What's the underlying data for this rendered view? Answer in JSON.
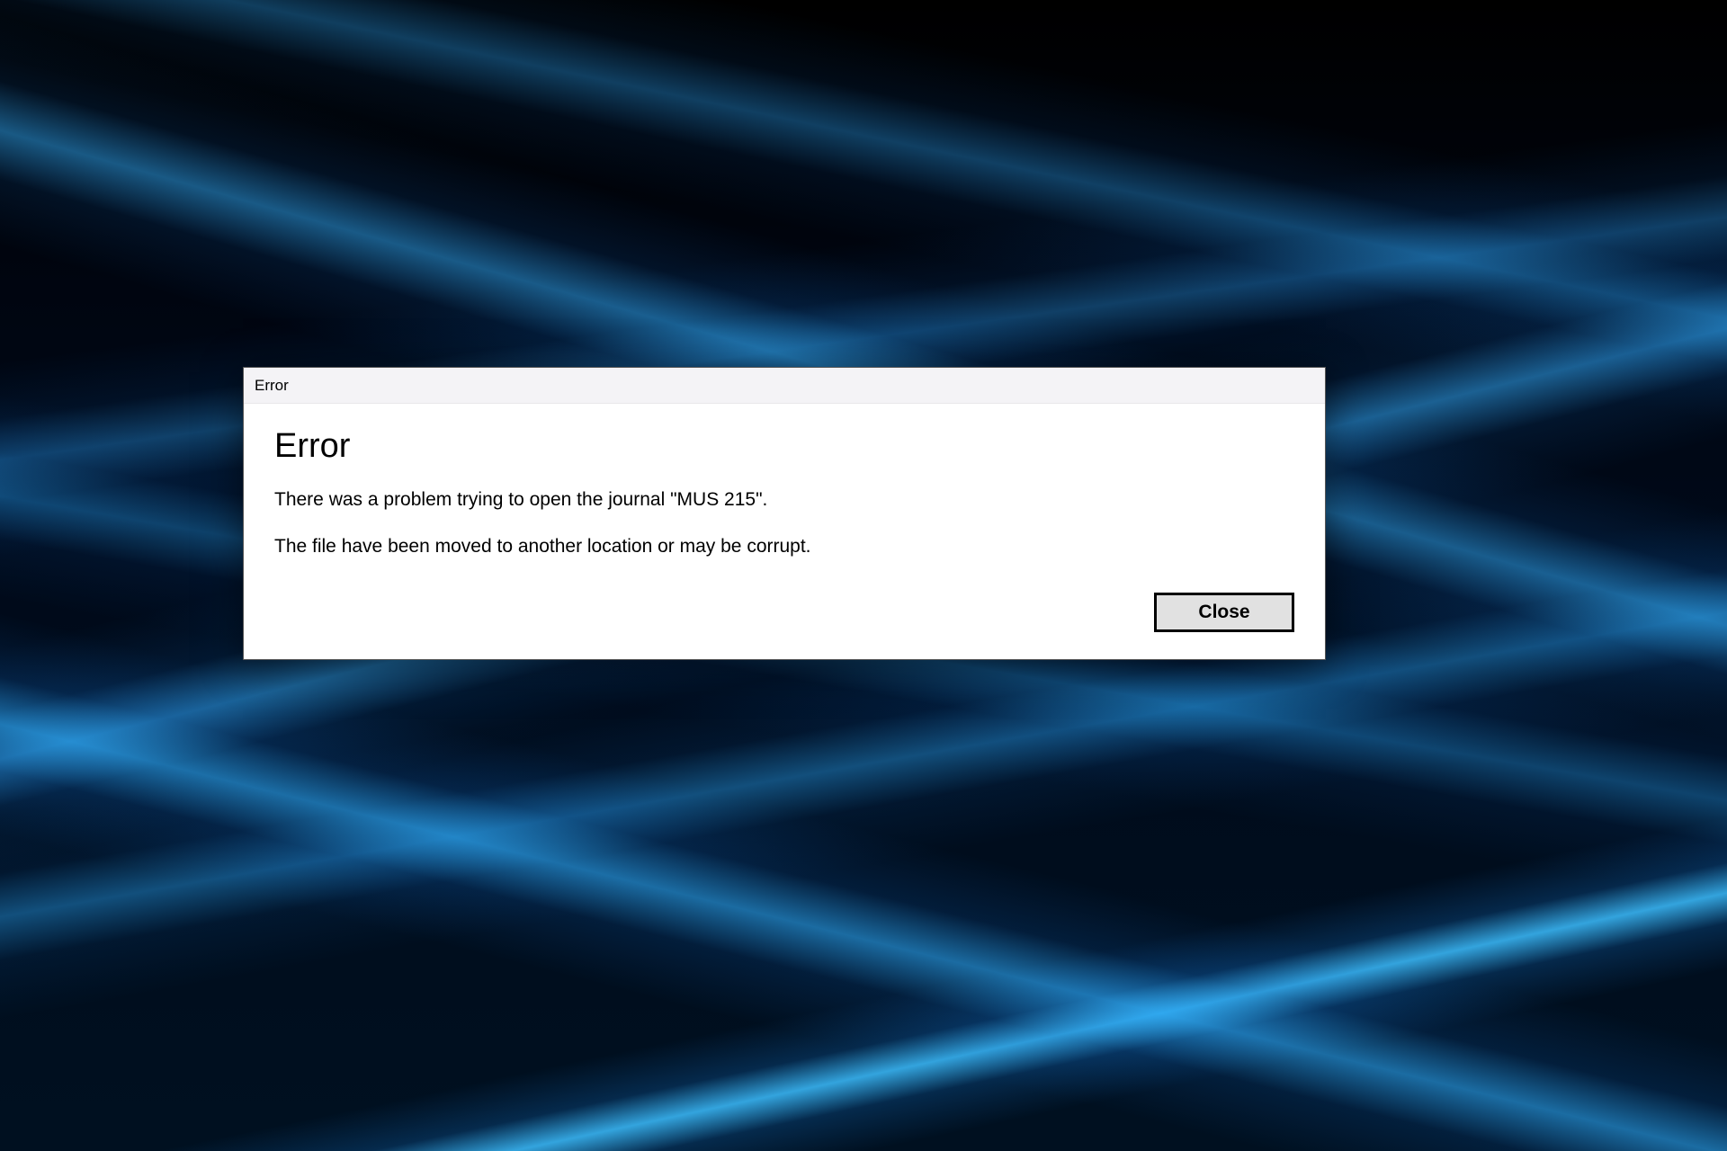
{
  "dialog": {
    "titlebar": "Error",
    "heading": "Error",
    "message_line1": "There was a problem trying to open the journal \"MUS 215\".",
    "message_line2": "The file have been moved to another location or may be corrupt.",
    "close_label": "Close"
  }
}
